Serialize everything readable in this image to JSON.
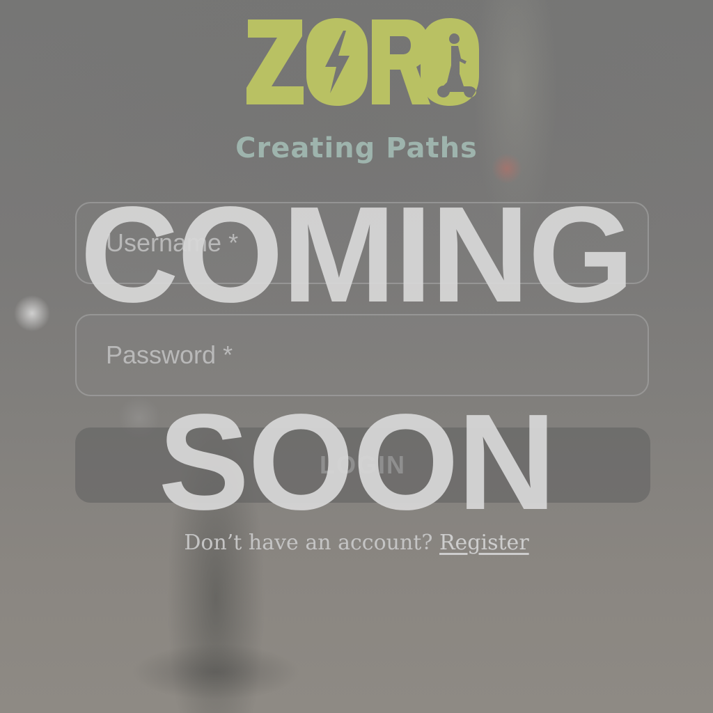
{
  "brand": {
    "logo_text": "ZORO",
    "tagline": "Creating Paths",
    "colors": {
      "logo": "#b9c163",
      "tagline": "#9eb4ad"
    }
  },
  "login_form": {
    "username_placeholder": "Username *",
    "password_placeholder": "Password *",
    "login_label": "LOGIN"
  },
  "overlay": {
    "line1": "COMING",
    "line2": "SOON"
  },
  "footer": {
    "prompt": "Don’t have an account?",
    "register_label": "Register"
  }
}
